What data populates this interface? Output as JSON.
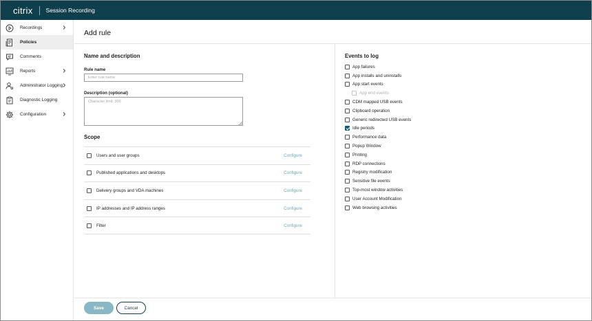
{
  "app": {
    "brand": "citrix",
    "product": "Session Recording"
  },
  "sidebar": {
    "items": [
      {
        "label": "Recordings",
        "icon": "play-circle-icon",
        "has_submenu": true
      },
      {
        "label": "Policies",
        "icon": "policy-document-icon",
        "active": true
      },
      {
        "label": "Comments",
        "icon": "comment-icon"
      },
      {
        "label": "Reports",
        "icon": "reports-icon",
        "has_submenu": true
      },
      {
        "label": "Administrator Logging",
        "icon": "admin-user-icon",
        "has_submenu": true
      },
      {
        "label": "Diagnostic Logging",
        "icon": "clipboard-icon"
      },
      {
        "label": "Configuration",
        "icon": "gear-icon",
        "has_submenu": true
      }
    ]
  },
  "page": {
    "title": "Add rule"
  },
  "name_section": {
    "title": "Name and description",
    "rule_name_label": "Rule name",
    "rule_name_placeholder": "Enter rule name",
    "rule_name_value": "",
    "description_label": "Description (optional)",
    "description_placeholder": "Character limit: 300",
    "description_value": ""
  },
  "scope": {
    "title": "Scope",
    "configure_label": "Configure",
    "items": [
      {
        "label": "Users and user groups",
        "checked": false
      },
      {
        "label": "Published applications and desktops",
        "checked": false
      },
      {
        "label": "Delivery groups and VDA machines",
        "checked": false
      },
      {
        "label": "IP addresses and IP address ranges",
        "checked": false
      },
      {
        "label": "Filter",
        "checked": false
      }
    ]
  },
  "events": {
    "title": "Events to log",
    "items": [
      {
        "label": "App failures",
        "checked": false
      },
      {
        "label": "App installs and uninstalls",
        "checked": false
      },
      {
        "label": "App start events",
        "checked": false
      },
      {
        "label": "App end events",
        "checked": false,
        "disabled": true,
        "sub": true
      },
      {
        "label": "CDM mapped USB events",
        "checked": false
      },
      {
        "label": "Clipboard operation",
        "checked": false
      },
      {
        "label": "Generic redirected USB events",
        "checked": false
      },
      {
        "label": "Idle periods",
        "checked": true
      },
      {
        "label": "Performance data",
        "checked": false
      },
      {
        "label": "Popup Window",
        "checked": false
      },
      {
        "label": "Printing",
        "checked": false
      },
      {
        "label": "RDP connections",
        "checked": false
      },
      {
        "label": "Registry modification",
        "checked": false
      },
      {
        "label": "Sensitive file events",
        "checked": false
      },
      {
        "label": "Top-most window activities",
        "checked": false
      },
      {
        "label": "User Account Modification",
        "checked": false
      },
      {
        "label": "Web browsing activities",
        "checked": false
      }
    ]
  },
  "footer": {
    "save_label": "Save",
    "cancel_label": "Cancel"
  },
  "colors": {
    "topbar": "#0f3e4d",
    "checkbox_checked": "#0f5f77",
    "configure_link": "#6fa6b3",
    "save_button": "#8ab7c5",
    "active_nav": "#eeeeee"
  }
}
